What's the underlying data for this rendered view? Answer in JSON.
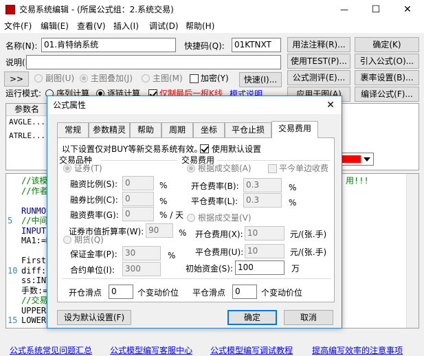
{
  "window": {
    "title": "交易系统编辑 - (所属公式组：2.系统交易)",
    "controls": [
      "—",
      "☐",
      "✕"
    ]
  },
  "menu": [
    "文件(F)",
    "编辑(E)",
    "查看(V)",
    "插入(I)",
    "调试(D)",
    "帮助(H)"
  ],
  "form": {
    "name_label": "名称(N):",
    "name_value": "01.肯特纳系统",
    "shortcut_label": "快捷码(Q):",
    "shortcut_value": "01KTNXT",
    "desc_label": "说明(D)",
    "desc_value": "",
    "expand_button": ">>",
    "subchart_label": "副图(U)",
    "overlay_label": "主图叠加(J)",
    "mainchart_label": "主图(M)",
    "encrypt_label": "加密(Y)",
    "speed_button": "快速(I)...",
    "runmode_label": "运行模式:",
    "runmode_seq": "序列计算",
    "runmode_each": "逐链计算",
    "last_bar_label": "仅制最后一根K线",
    "mode_desc_link": "模式说明"
  },
  "right_buttons": [
    "用法注释(R)...",
    "确定(K)",
    "使用TEST(P)...",
    "引入公式(O)...",
    "公式测评(E)...",
    "裹率设置(B)...",
    "应用于图(A)",
    "编译公式(F)..."
  ],
  "param_table": {
    "header": "参数名",
    "rows": [
      "AVGLE...",
      "ATRLE..."
    ]
  },
  "code_lines": [
    {
      "num": "",
      "text": "//该模",
      "color": "#008000"
    },
    {
      "num": "",
      "text": "//作者",
      "color": "#008000"
    },
    {
      "num": "",
      "text": "",
      "color": "#000"
    },
    {
      "num": "",
      "text": "RUNMOD",
      "color": "#000080"
    },
    {
      "num": "5",
      "text": "//中间",
      "color": "#008000"
    },
    {
      "num": "",
      "text": "INPUT",
      "color": "#000080"
    },
    {
      "num": "",
      "text": "MA1:=M",
      "color": "#000"
    },
    {
      "num": "",
      "text": "",
      "color": "#000"
    },
    {
      "num": "",
      "text": "FirstL",
      "color": "#000"
    },
    {
      "num": "10",
      "text": "diff:I",
      "color": "#000"
    },
    {
      "num": "",
      "text": "ss:INT",
      "color": "#000"
    },
    {
      "num": "",
      "text": "手数:=",
      "color": "#000"
    },
    {
      "num": "",
      "text": "//交易",
      "color": "#008000"
    },
    {
      "num": "",
      "text": "UPPERR",
      "color": "#000"
    },
    {
      "num": "15",
      "text": "LOWERR",
      "color": "#000"
    }
  ],
  "code_right_snippet": "用!!!",
  "links": [
    "公式系统常见问题汇总",
    "公式模型编写客服中心",
    "公式模型编写调试教程",
    "提高编写效率的注意事项"
  ],
  "dialog": {
    "title": "公式属性",
    "tabs": [
      "常规",
      "参数精灵",
      "帮助",
      "周期",
      "坐标",
      "平仓止损",
      "交易费用"
    ],
    "active_tab": "交易费用",
    "notice": "以下设置仅对BUY等新交易系统有效。",
    "use_default_label": "使用默认设置",
    "variety": {
      "group_label": "交易品种",
      "securities_label": "证券(T)",
      "margin_ratio_label": "融资比例(S):",
      "margin_ratio_value": "0",
      "short_ratio_label": "融券比例(C):",
      "short_ratio_value": "0",
      "financing_rate_label": "融资费率(G):",
      "financing_rate_value": "0",
      "financing_unit": "% / 天",
      "market_value_label": "证券市值折算率(W):",
      "market_value_value": "90",
      "futures_label": "期货(Q)",
      "deposit_label": "保证金率(P):",
      "deposit_value": "30",
      "contract_label": "合约单位(I):",
      "contract_value": "300",
      "percent": "%"
    },
    "fees": {
      "group_label": "交易费用",
      "by_amount_label": "根据成交额(A)",
      "today_single_label": "平今单边收费",
      "open_rate_label": "开仓费率(B):",
      "open_rate_value": "0.3",
      "close_rate_label": "平仓费率(L):",
      "close_rate_value": "0.3",
      "by_volume_label": "根据成交量(V)",
      "open_fee_label": "开仓费用(X):",
      "open_fee_value": "10",
      "close_fee_label": "平仓费用(U):",
      "close_fee_value": "10",
      "fee_unit": "元/(张.手)",
      "capital_label": "初始资金(S):",
      "capital_value": "100",
      "capital_unit": "万",
      "percent": "%"
    },
    "open_slip_label": "开仓滑点",
    "open_slip_value": "0",
    "close_slip_label": "平仓滑点",
    "close_slip_value": "0",
    "slip_unit": "个变动价位",
    "set_default_button": "设为默认设置(F)",
    "ok_button": "确定",
    "cancel_button": "取消"
  },
  "accent_red": "#ff0000",
  "titlebar_blue": "#0078d7"
}
